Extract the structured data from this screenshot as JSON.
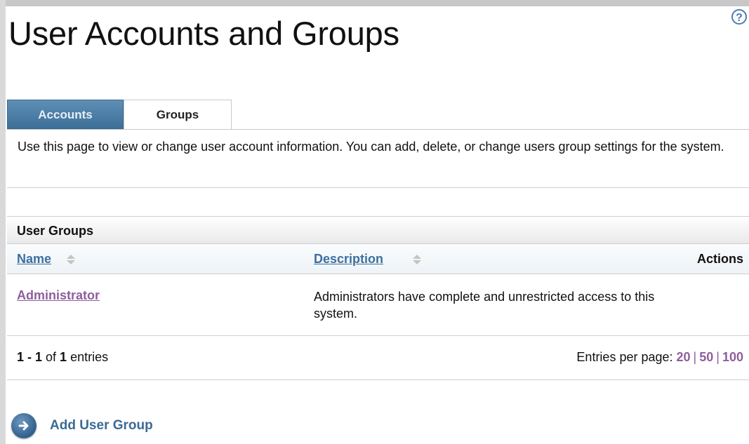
{
  "page": {
    "title": "User Accounts and Groups",
    "help_glyph": "?"
  },
  "tabs": [
    {
      "label": "Accounts",
      "active": false
    },
    {
      "label": "Groups",
      "active": true
    }
  ],
  "intro": {
    "text": "Use this page to view or change user account information. You can add, delete, or change users group settings for the system."
  },
  "section": {
    "title": "User Groups"
  },
  "table": {
    "columns": {
      "name": "Name",
      "description": "Description",
      "actions": "Actions"
    },
    "rows": [
      {
        "name": "Administrator",
        "description": "Administrators have complete and unrestricted access to this system."
      }
    ]
  },
  "pagination": {
    "range_start": "1",
    "range_sep": " - ",
    "range_end": "1",
    "of_text": " of ",
    "total": "1",
    "entries_text": " entries",
    "per_page_label": "Entries per page: ",
    "options": [
      "20",
      "50",
      "100"
    ]
  },
  "actions": {
    "add_group_label": "Add User Group"
  },
  "icons": {
    "help": "help-icon",
    "sort": "sort-icon",
    "add": "arrow-right-icon"
  },
  "colors": {
    "tab_active_bg": "#ffffff",
    "tab_inactive_bg": "#4a7ca4",
    "link_visited": "#8e5e9e",
    "link": "#3b6fa0"
  }
}
